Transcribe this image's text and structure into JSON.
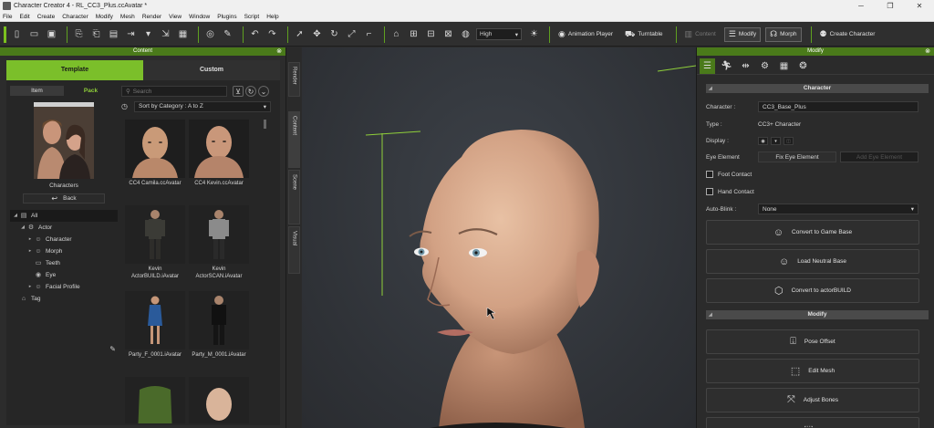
{
  "window": {
    "title": "Character Creator 4 - RL_CC3_Plus.ccAvatar *",
    "controls": [
      "─",
      "❐",
      "✕"
    ]
  },
  "menu": [
    "File",
    "Edit",
    "Create",
    "Character",
    "Modify",
    "Mesh",
    "Render",
    "View",
    "Window",
    "Plugins",
    "Script",
    "Help"
  ],
  "toolbar": {
    "quality_value": "High",
    "animation_player": "Animation Player",
    "turntable": "Turntable",
    "content_dim": "Content",
    "modify": "Modify",
    "morph": "Morph",
    "create_character": "Create Character"
  },
  "content_panel": {
    "title": "Content",
    "tab_template": "Template",
    "tab_custom": "Custom",
    "subtab_item": "Item",
    "subtab_pack": "Pack",
    "folder_label": "Characters",
    "back_label": "Back",
    "tree": [
      {
        "label": "All",
        "caret": "◢",
        "icon": "▤",
        "indent": 0,
        "selected": true
      },
      {
        "label": "Actor",
        "caret": "◢",
        "icon": "⚙",
        "indent": 1,
        "selected": false
      },
      {
        "label": "Character",
        "caret": "▸",
        "icon": "☺",
        "indent": 2,
        "selected": false
      },
      {
        "label": "Morph",
        "caret": "▸",
        "icon": "☺",
        "indent": 2,
        "selected": false
      },
      {
        "label": "Teeth",
        "caret": "",
        "icon": "▭",
        "indent": 2,
        "selected": false
      },
      {
        "label": "Eye",
        "caret": "",
        "icon": "◉",
        "indent": 2,
        "selected": false
      },
      {
        "label": "Facial Profile",
        "caret": "▸",
        "icon": "☺",
        "indent": 2,
        "selected": false
      },
      {
        "label": "Tag",
        "caret": "",
        "icon": "⌂",
        "indent": 0,
        "selected": false
      }
    ],
    "search_placeholder": "Search",
    "sort_value": "Sort by Category : A to Z",
    "items": [
      {
        "label": "CC4 Camila.ccAvatar"
      },
      {
        "label": "CC4 Kevin.ccAvatar"
      },
      {
        "label": "Kevin ActorBUILD.iAvatar"
      },
      {
        "label": "Kevin ActorSCAN.iAvatar"
      },
      {
        "label": "Party_F_0001.iAvatar"
      },
      {
        "label": "Party_M_0001.iAvatar"
      },
      {
        "label": ""
      },
      {
        "label": ""
      }
    ]
  },
  "side_tabs": [
    "Render",
    "Content",
    "Scene",
    "Visual"
  ],
  "modify_panel": {
    "title": "Modify",
    "section_character": "Character",
    "character_label": "Character :",
    "character_value": "CC3_Base_Plus",
    "type_label": "Type :",
    "type_value": "CC3+ Character",
    "display_label": "Display :",
    "eye_element_label": "Eye Element",
    "fix_eye_button": "Fix Eye Element",
    "add_eye_button": "Add Eye Element",
    "foot_contact": "Foot Contact",
    "hand_contact": "Hand Contact",
    "autoblink_label": "Auto-Blink :",
    "autoblink_value": "None",
    "convert_game_base": "Convert to Game Base",
    "load_neutral_base": "Load Neutral Base",
    "convert_actorbuild": "Convert to actorBUILD",
    "section_modify": "Modify",
    "pose_offset": "Pose Offset",
    "edit_mesh": "Edit Mesh",
    "adjust_bones": "Adjust Bones"
  },
  "colors": {
    "accent_green": "#7bbf2a",
    "panel_header": "#4a7a1a",
    "background": "#2b2b2b"
  }
}
